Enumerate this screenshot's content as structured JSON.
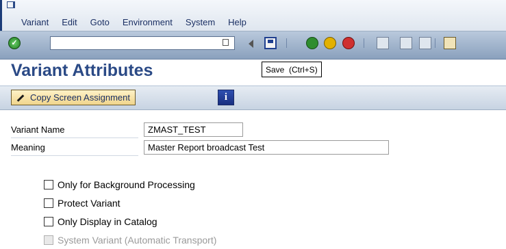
{
  "menubar": {
    "items": [
      "Variant",
      "Edit",
      "Goto",
      "Environment",
      "System",
      "Help"
    ]
  },
  "toolbar": {
    "icons": [
      "enter-icon",
      "save-icon",
      "back-icon",
      "exit-icon",
      "cancel-icon",
      "print-icon",
      "find-icon",
      "find-next-icon",
      "new-session-icon"
    ]
  },
  "header": {
    "title": "Variant Attributes",
    "tooltip": "Save  (Ctrl+S)"
  },
  "appbar": {
    "copy_button": "Copy Screen Assignment",
    "info_icon_text": "i"
  },
  "form": {
    "variant_name_label": "Variant Name",
    "variant_name_value": "ZMAST_TEST",
    "meaning_label": "Meaning",
    "meaning_value": "Master Report broadcast Test"
  },
  "options": {
    "background": "Only for Background Processing",
    "protect": "Protect Variant",
    "catalog": "Only Display in Catalog",
    "system": "System Variant (Automatic Transport)"
  },
  "colors": {
    "title": "#2b4a86",
    "toolbar": "#8aa1bd",
    "button": "#f0d58c"
  }
}
